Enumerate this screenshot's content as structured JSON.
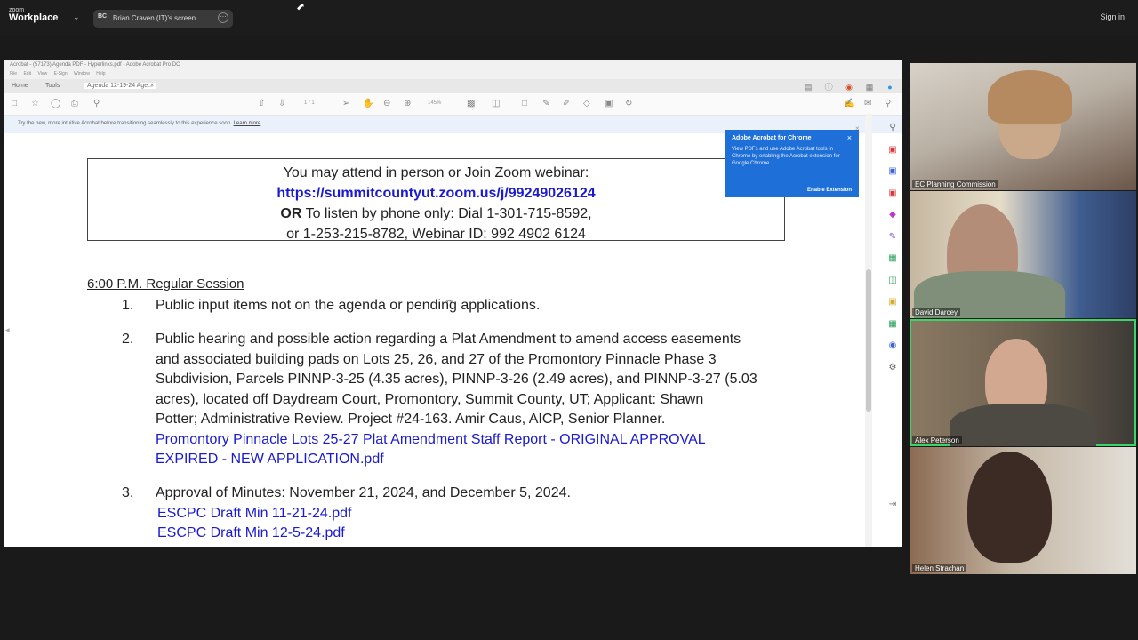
{
  "zoom": {
    "logo_line1": "zoom",
    "logo_line2": "Workplace",
    "share_avatar": "BC",
    "share_label": "Brian Craven (IT)'s screen",
    "sign_in": "Sign in"
  },
  "browser": {
    "title": "Acrobat - (57173) Agenda PDF - Hyperlinks.pdf - Adobe Acrobat Pro DC",
    "menu": [
      "File",
      "Edit",
      "View",
      "E-Sign",
      "Window",
      "Help"
    ],
    "tabs": [
      "Home",
      "Tools",
      "Agenda 12-19-24 Age..."
    ],
    "page_indicator": "1 / 1",
    "zoom_level": "145%",
    "banner_text": "Try the new, more intuitive Acrobat before transitioning seamlessly to this experience soon.",
    "banner_link": "Learn more"
  },
  "popup": {
    "title": "Adobe Acrobat for Chrome",
    "desc": "View PDFs and use Adobe Acrobat tools in Chrome by enabling the Acrobat extension for Google Chrome.",
    "button": "Enable Extension"
  },
  "document": {
    "box_line1": "You may attend in person or Join Zoom webinar:",
    "box_link": "https://summitcountyut.zoom.us/j/99249026124",
    "box_line3_bold": "OR",
    "box_line3": "To listen by phone only: Dial 1-301-715-8592,",
    "box_line4": "or 1-253-215-8782, Webinar ID: 992 4902 6124",
    "session": "6:00 P.M. Regular Session",
    "items": [
      {
        "num": "1.",
        "text": "Public input items not on the agenda or pending applications."
      },
      {
        "num": "2.",
        "lines": [
          "Public hearing and possible action regarding a Plat Amendment to amend access easements",
          "and associated building pads on Lots 25, 26, and 27 of the Promontory Pinnacle Phase 3",
          "Subdivision, Parcels PINNP-3-25 (4.35 acres), PINNP-3-26 (2.49 acres), and PINNP-3-27 (5.03",
          "acres), located off Daydream Court, Promontory, Summit County, UT; Applicant: Shawn",
          "Potter; Administrative Review. Project #24-163. Amir Caus, AICP, Senior Planner."
        ],
        "links": [
          "Promontory Pinnacle Lots 25-27 Plat Amendment Staff Report - ORIGINAL APPROVAL",
          "EXPIRED - NEW APPLICATION.pdf"
        ]
      },
      {
        "num": "3.",
        "text": "Approval of Minutes: November 21, 2024, and December 5, 2024.",
        "links": [
          "ESCPC Draft Min 11-21-24.pdf",
          "ESCPC Draft Min 12-5-24.pdf"
        ]
      }
    ]
  },
  "participants": [
    {
      "name": "EC Planning Commission",
      "active": false
    },
    {
      "name": "David Darcey",
      "active": false
    },
    {
      "name": "Alex Peterson",
      "active": true
    },
    {
      "name": "Helen Strachan",
      "active": false
    }
  ],
  "colors": {
    "link": "#1a1ad0",
    "active_speaker": "#3ad46b",
    "popup_bg": "#1f6fd8"
  }
}
